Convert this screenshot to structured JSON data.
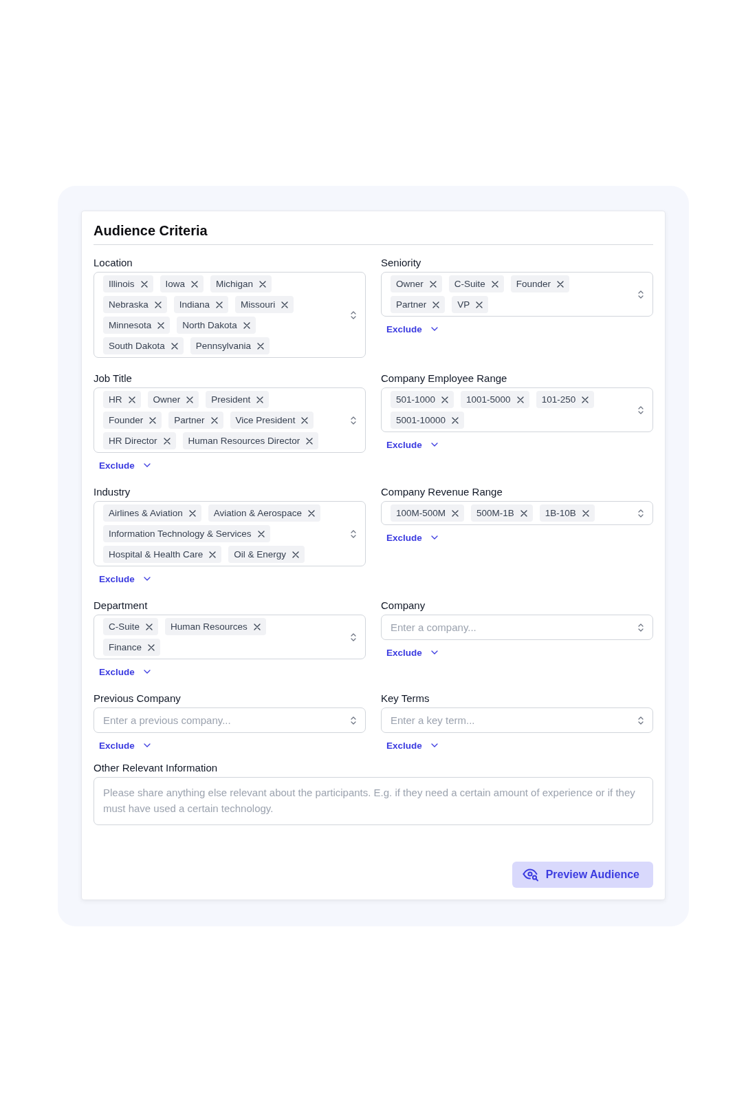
{
  "title": "Audience Criteria",
  "rows": [
    [
      {
        "label": "Location",
        "kind": "tags",
        "tags": [
          "Illinois",
          "Iowa",
          "Michigan",
          "Nebraska",
          "Indiana",
          "Missouri",
          "Minnesota",
          "North Dakota",
          "South Dakota",
          "Pennsylvania"
        ]
      },
      {
        "label": "Seniority",
        "kind": "tags",
        "tags": [
          "Owner",
          "C-Suite",
          "Founder",
          "Partner",
          "VP"
        ],
        "exclude": "Exclude"
      }
    ],
    [
      {
        "label": "Job Title",
        "kind": "tags",
        "tags": [
          "HR",
          "Owner",
          "President",
          "Founder",
          "Partner",
          "Vice President",
          "HR Director",
          "Human Resources Director"
        ],
        "exclude": "Exclude"
      },
      {
        "label": "Company Employee Range",
        "kind": "tags",
        "tags": [
          "501-1000",
          "1001-5000",
          "101-250",
          "5001-10000"
        ],
        "exclude": "Exclude"
      }
    ],
    [
      {
        "label": "Industry",
        "kind": "tags",
        "tags": [
          "Airlines & Aviation",
          "Aviation & Aerospace",
          "Information Technology & Services",
          "Hospital & Health Care",
          "Oil & Energy"
        ],
        "exclude": "Exclude"
      },
      {
        "label": "Company Revenue Range",
        "kind": "tags",
        "tags": [
          "100M-500M",
          "500M-1B",
          "1B-10B"
        ],
        "exclude": "Exclude"
      }
    ],
    [
      {
        "label": "Department",
        "kind": "tags",
        "tags": [
          "C-Suite",
          "Human Resources",
          "Finance"
        ],
        "exclude": "Exclude"
      },
      {
        "label": "Company",
        "kind": "input",
        "placeholder": "Enter a company...",
        "exclude": "Exclude"
      }
    ],
    [
      {
        "label": "Previous Company",
        "kind": "input",
        "placeholder": "Enter a previous company...",
        "exclude": "Exclude"
      },
      {
        "label": "Key Terms",
        "kind": "input",
        "placeholder": "Enter a key term...",
        "exclude": "Exclude"
      }
    ]
  ],
  "other": {
    "label": "Other Relevant Information",
    "placeholder": "Please share anything else relevant about the participants. E.g. if they need a certain amount of experience or if they must have used a certain technology."
  },
  "button": "Preview Audience"
}
